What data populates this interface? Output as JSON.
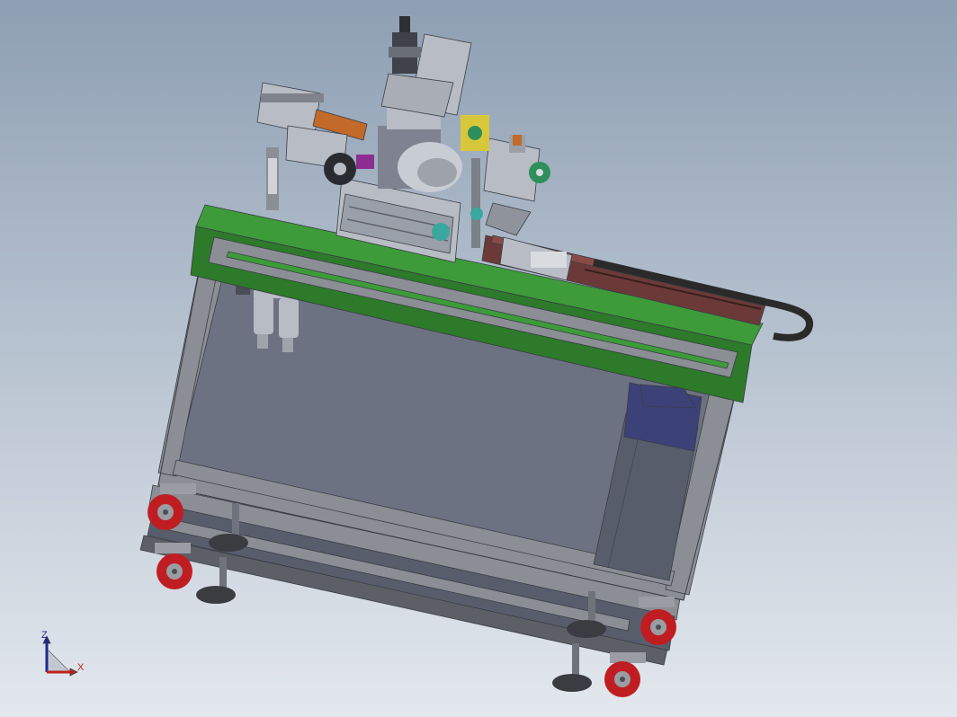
{
  "viewport": {
    "background_top": "#8e9fb3",
    "background_bottom": "#e3e8ee"
  },
  "triad": {
    "z_label": "Z",
    "x_label": "X",
    "z_color": "#1c2a8f",
    "x_color": "#c0231a"
  },
  "colors": {
    "frame": "#8b8f95",
    "frame_dark": "#5c6066",
    "panel": "#6d7282",
    "panel_dark": "#585d6c",
    "table_top": "#3d9b3a",
    "table_top_edge": "#2c7a2a",
    "rail": "#6b3a38",
    "cable_chain": "#2a2a2a",
    "caster_wheel": "#c01d22",
    "caster_hub": "#9a9da3",
    "motor_body": "#7f8390",
    "bracket": "#b8bcc4",
    "accent_teal": "#3aa7a0",
    "accent_purple": "#8b2e8f",
    "accent_orange": "#c26a2a",
    "accent_yellow": "#d8c73a",
    "accent_green_gear": "#2f8f5a",
    "tank_blue": "#3c4178"
  }
}
